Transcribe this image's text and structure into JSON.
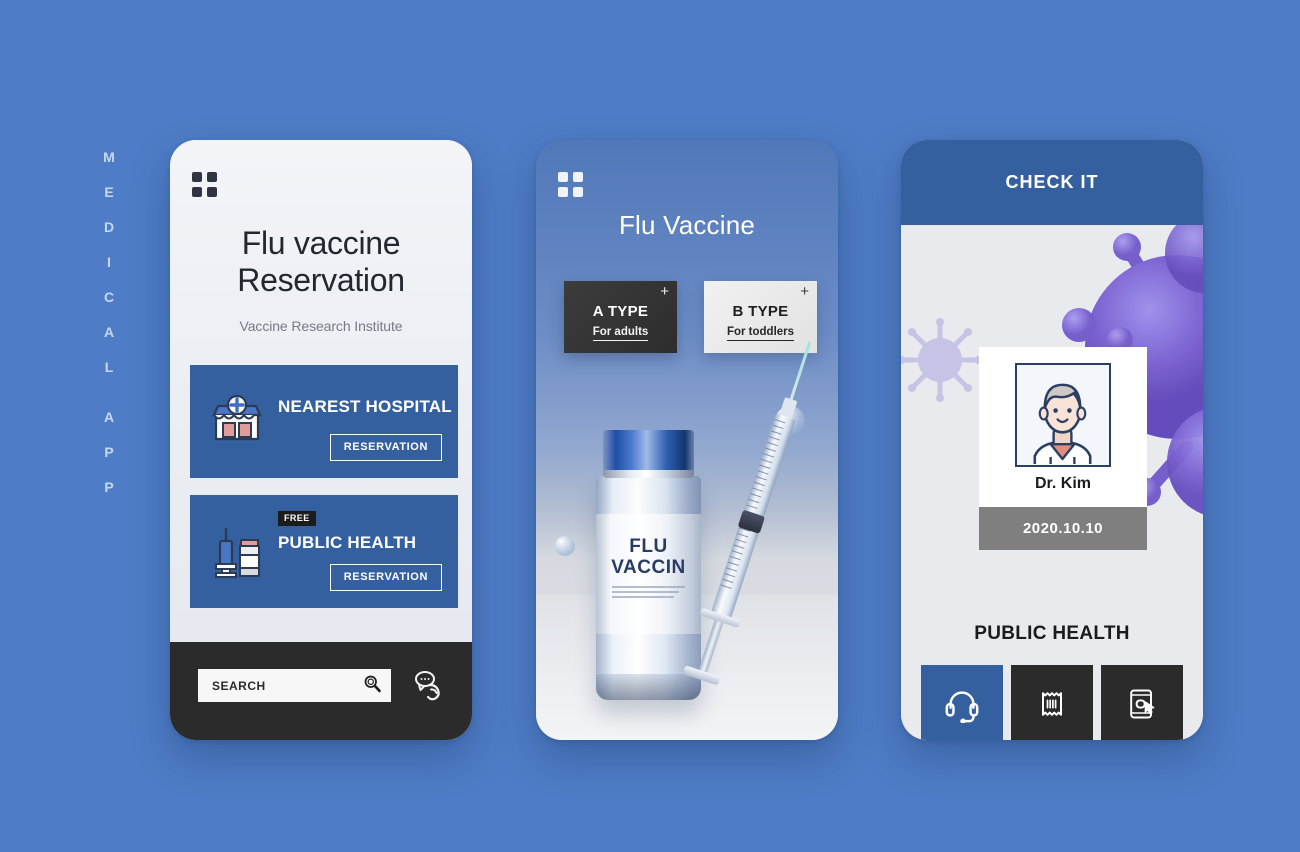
{
  "side_label": {
    "text": "MEDICAL APP",
    "letters": [
      "M",
      "E",
      "D",
      "I",
      "C",
      "A",
      "L",
      "A",
      "P",
      "P"
    ]
  },
  "colors": {
    "background_blue": "#4e7cc6",
    "card_blue": "#35609f",
    "dark": "#2b2b2b",
    "light_panel": "#e8eaee",
    "gray_band": "#7f7f7f",
    "virus_purple": "#7b6ad4"
  },
  "phone1": {
    "menu_icon": "grid-menu-icon",
    "title_line1": "Flu vaccine",
    "title_line2": "Reservation",
    "subtitle": "Vaccine Research Institute",
    "cards": [
      {
        "icon": "hospital-icon",
        "title": "NEAREST HOSPITAL",
        "button": "RESERVATION",
        "badge": null
      },
      {
        "icon": "syringe-vial-icon",
        "title": "PUBLIC HEALTH",
        "button": "RESERVATION",
        "badge": "FREE"
      }
    ],
    "search": {
      "value": "SEARCH",
      "placeholder": "SEARCH",
      "icon": "search-icon"
    },
    "support_icon": "phone-support-icon"
  },
  "phone2": {
    "menu_icon": "grid-menu-icon",
    "title": "Flu Vaccine",
    "type_cards": [
      {
        "name": "A TYPE",
        "desc": "For adults",
        "plus": "+",
        "selected": true
      },
      {
        "name": "B TYPE",
        "desc": "For toddlers",
        "plus": "+",
        "selected": false
      }
    ],
    "vial": {
      "label_line1": "FLU",
      "label_line2": "VACCIN"
    }
  },
  "phone3": {
    "header_title": "CHECK IT",
    "id_card": {
      "photo_icon": "doctor-portrait-icon",
      "name": "Dr. Kim",
      "date": "2020.10.10"
    },
    "label": "PUBLIC HEALTH",
    "actions": [
      {
        "icon": "headset-icon",
        "style": "blue"
      },
      {
        "icon": "receipt-icon",
        "style": "dark"
      },
      {
        "icon": "mobile-touch-icon",
        "style": "dark"
      }
    ]
  }
}
